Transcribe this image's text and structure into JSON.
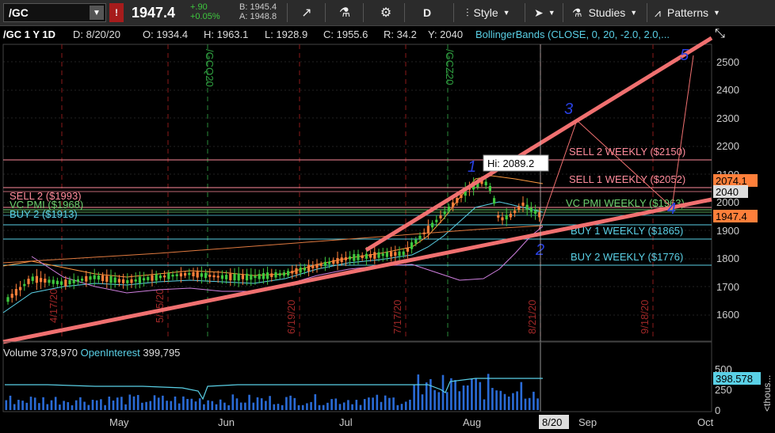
{
  "toolbar": {
    "symbol": "/GC",
    "last": "1947.4",
    "change": "+.90",
    "change_pct": "+0.05%",
    "bid": "B: 1945.4",
    "ask": "A: 1948.8",
    "aggregation": "D",
    "style_label": "Style",
    "studies_label": "Studies",
    "patterns_label": "Patterns"
  },
  "infobar": {
    "title": "/GC 1 Y 1D",
    "date": "D: 8/20/20",
    "open": "O: 1934.4",
    "high": "H: 1963.1",
    "low": "L: 1928.9",
    "close": "C: 1955.6",
    "range": "R: 34.2",
    "y": "Y: 2040",
    "study": "BollingerBands (CLOSE, 0, 20, -2.0, 2.0,..."
  },
  "price_axis": {
    "ticks": [
      "2500",
      "2400",
      "2300",
      "2200",
      "2100",
      "2000",
      "1900",
      "1800",
      "1700",
      "1600"
    ],
    "badge_2074": "2074.1",
    "badge_2040": "2040",
    "badge_last": "1947.4"
  },
  "levels": {
    "sell2_weekly": "SELL 2 WEEKLY ($2150)",
    "sell1_weekly": "SELL 1 WEEKLY ($2052)",
    "vc_pmi_weekly": "VC PMI WEEKLY ($1963)",
    "buy1_weekly": "BUY 1 WEEKLY ($1865)",
    "buy2_weekly": "BUY 2 WEEKLY ($1776)",
    "sell2_daily": "SELL 2 ($1993)",
    "vcpmi_daily": "VC PMI ($1968)",
    "buy2_daily": "BUY 2 ($1913)",
    "hi_label": "Hi: 2089.2"
  },
  "wave_labels": [
    "1",
    "2",
    "3",
    "4",
    "5"
  ],
  "expiry_labels": [
    "/GCQ20",
    "/GCZ20"
  ],
  "date_marks": [
    "4/17/20",
    "5/15/20",
    "6/19/20",
    "7/17/20",
    "8/21/20",
    "9/18/20"
  ],
  "volume": {
    "label": "Volume",
    "value": "378,970",
    "oi_label": "OpenInterest",
    "oi_value": "399,795",
    "ticks": [
      "500",
      "250",
      "0"
    ],
    "badge": "398.578",
    "unit": "<thous..."
  },
  "months": [
    "May",
    "Jun",
    "Jul",
    "Aug",
    "Sep",
    "Oct"
  ],
  "current_date_badge": "8/20",
  "colors": {
    "up": "#3ec83e",
    "down": "#ff7f3a",
    "trend": "#f07070",
    "level_blue": "#5ad0e6",
    "level_red": "#ff8c9c",
    "volume": "#2a6bd6"
  }
}
